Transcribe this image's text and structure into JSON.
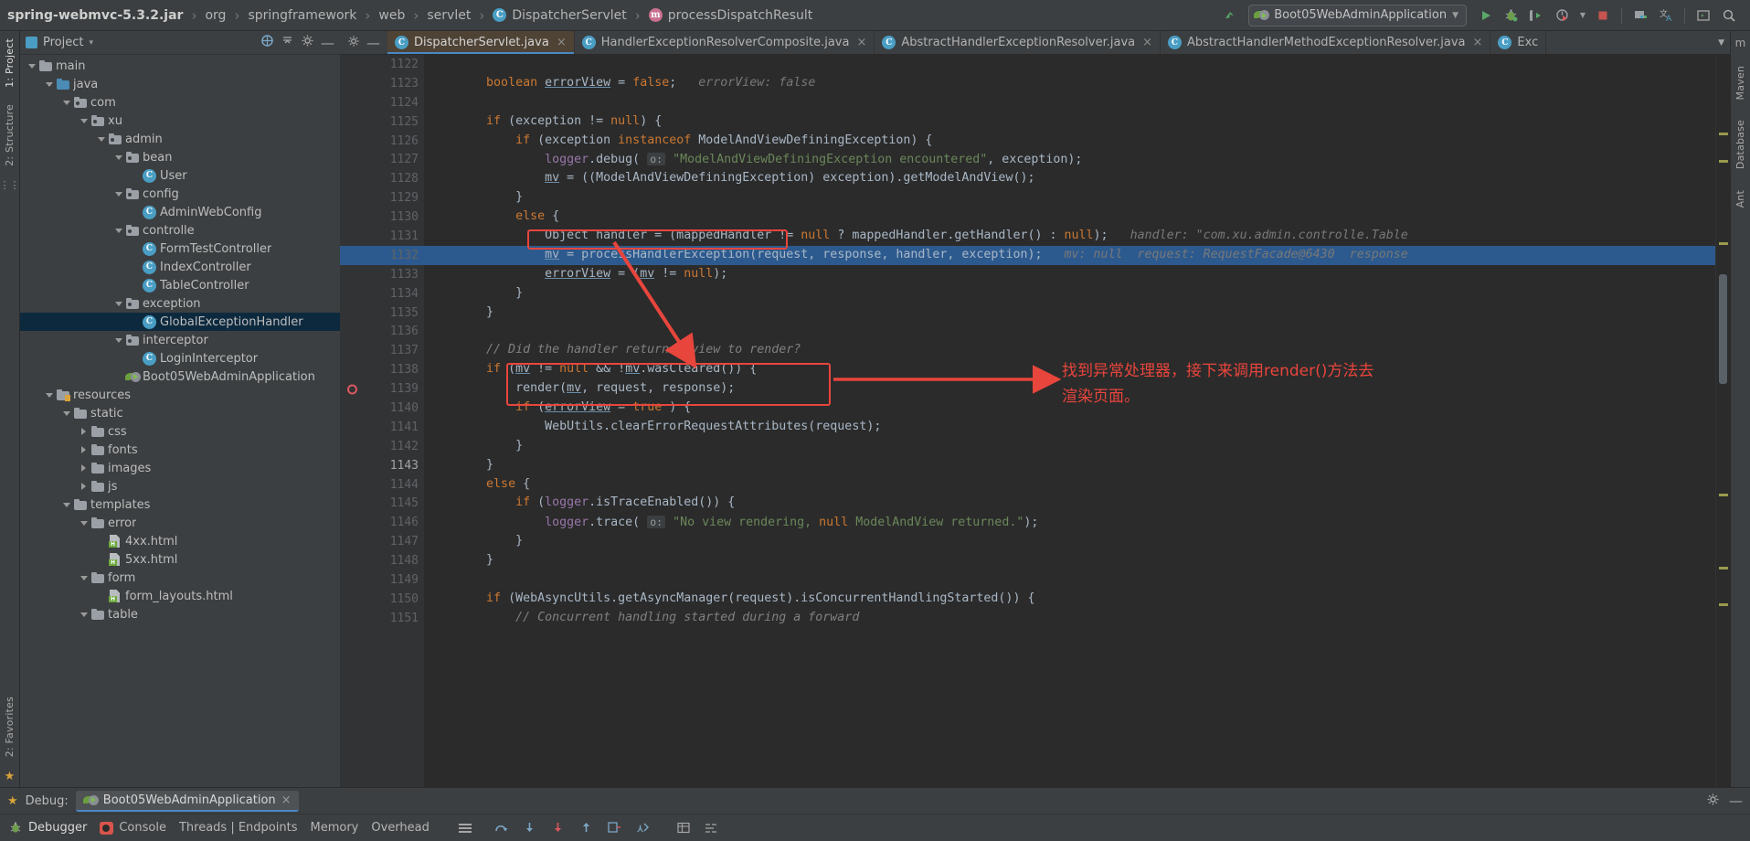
{
  "breadcrumb": {
    "items": [
      {
        "label": "spring-webmvc-5.3.2.jar",
        "icon": "",
        "bold": true
      },
      {
        "label": "org",
        "icon": ""
      },
      {
        "label": "springframework",
        "icon": ""
      },
      {
        "label": "web",
        "icon": ""
      },
      {
        "label": "servlet",
        "icon": ""
      },
      {
        "label": "DispatcherServlet",
        "icon": "class-icon"
      },
      {
        "label": "processDispatchResult",
        "icon": "method-icon"
      }
    ],
    "separator": "›"
  },
  "toolbar": {
    "run_config": "Boot05WebAdminApplication",
    "run_config_chevron": "▼",
    "build_label": "build-icon",
    "run_label": "run-icon",
    "debug_label": "debug-icon",
    "run_coverage_label": "run-with-coverage-icon",
    "profiler_label": "profiler-icon",
    "stop_label": "stop-icon",
    "project_structure_label": "project-structure-icon",
    "translate_label": "translate-icon",
    "terminal_label": "terminal-icon",
    "search_label": "search-icon"
  },
  "project_panel": {
    "title": "Project",
    "title_chevron": "▾",
    "header_icons": [
      "select-opened-file-icon",
      "collapse-all-icon",
      "settings-icon",
      "hide-icon"
    ],
    "tree": [
      {
        "depth": 1,
        "twisty": "down",
        "icon": "folder",
        "label": "main"
      },
      {
        "depth": 2,
        "twisty": "down",
        "icon": "folder-blue",
        "label": "java"
      },
      {
        "depth": 3,
        "twisty": "down",
        "icon": "package",
        "label": "com"
      },
      {
        "depth": 4,
        "twisty": "down",
        "icon": "package",
        "label": "xu"
      },
      {
        "depth": 5,
        "twisty": "down",
        "icon": "package",
        "label": "admin"
      },
      {
        "depth": 6,
        "twisty": "down",
        "icon": "package",
        "label": "bean"
      },
      {
        "depth": 7,
        "twisty": "none",
        "icon": "class",
        "label": "User"
      },
      {
        "depth": 6,
        "twisty": "down",
        "icon": "package",
        "label": "config"
      },
      {
        "depth": 7,
        "twisty": "none",
        "icon": "class",
        "label": "AdminWebConfig"
      },
      {
        "depth": 6,
        "twisty": "down",
        "icon": "package",
        "label": "controlle"
      },
      {
        "depth": 7,
        "twisty": "none",
        "icon": "class",
        "label": "FormTestController"
      },
      {
        "depth": 7,
        "twisty": "none",
        "icon": "class",
        "label": "IndexController"
      },
      {
        "depth": 7,
        "twisty": "none",
        "icon": "class",
        "label": "TableController"
      },
      {
        "depth": 6,
        "twisty": "down",
        "icon": "package",
        "label": "exception"
      },
      {
        "depth": 7,
        "twisty": "none",
        "icon": "class",
        "label": "GlobalExceptionHandler",
        "selected": true
      },
      {
        "depth": 6,
        "twisty": "down",
        "icon": "package",
        "label": "interceptor"
      },
      {
        "depth": 7,
        "twisty": "none",
        "icon": "class",
        "label": "LoginInterceptor"
      },
      {
        "depth": 6,
        "twisty": "none",
        "icon": "spring-boot",
        "label": "Boot05WebAdminApplication"
      },
      {
        "depth": 2,
        "twisty": "down",
        "icon": "resources",
        "label": "resources"
      },
      {
        "depth": 3,
        "twisty": "down",
        "icon": "folder",
        "label": "static"
      },
      {
        "depth": 4,
        "twisty": "right",
        "icon": "folder",
        "label": "css"
      },
      {
        "depth": 4,
        "twisty": "right",
        "icon": "folder",
        "label": "fonts"
      },
      {
        "depth": 4,
        "twisty": "right",
        "icon": "folder",
        "label": "images"
      },
      {
        "depth": 4,
        "twisty": "right",
        "icon": "folder",
        "label": "js"
      },
      {
        "depth": 3,
        "twisty": "down",
        "icon": "folder",
        "label": "templates"
      },
      {
        "depth": 4,
        "twisty": "down",
        "icon": "folder",
        "label": "error"
      },
      {
        "depth": 5,
        "twisty": "none",
        "icon": "html",
        "label": "4xx.html"
      },
      {
        "depth": 5,
        "twisty": "none",
        "icon": "html",
        "label": "5xx.html"
      },
      {
        "depth": 4,
        "twisty": "down",
        "icon": "folder",
        "label": "form"
      },
      {
        "depth": 5,
        "twisty": "none",
        "icon": "html",
        "label": "form_layouts.html"
      },
      {
        "depth": 4,
        "twisty": "down",
        "icon": "folder",
        "label": "table"
      }
    ]
  },
  "left_rail": {
    "top": "1: Project",
    "middle": "2: Structure",
    "bottom": "2: Favorites",
    "bottom_icon": "star-icon"
  },
  "right_rail": {
    "items": [
      "m",
      "Maven",
      "Database",
      "Ant"
    ]
  },
  "editor_tabs": [
    {
      "label": "DispatcherServlet.java",
      "icon": "class-icon",
      "active": true,
      "close": "×"
    },
    {
      "label": "HandlerExceptionResolverComposite.java",
      "icon": "class-icon",
      "active": false,
      "close": "×"
    },
    {
      "label": "AbstractHandlerExceptionResolver.java",
      "icon": "class-icon",
      "active": false,
      "close": "×"
    },
    {
      "label": "AbstractHandlerMethodExceptionResolver.java",
      "icon": "class-icon",
      "active": false,
      "close": "×"
    },
    {
      "label": "Exc",
      "icon": "class-icon",
      "active": false,
      "close": ""
    }
  ],
  "editor": {
    "first_line_number": 1122,
    "highlighted_line": 1132,
    "breakpoint_line": 1139,
    "current_line": 1143,
    "lines": [
      {
        "num": 1122,
        "text": ""
      },
      {
        "num": 1123,
        "text": "boolean errorView = false;   errorView: false"
      },
      {
        "num": 1124,
        "text": ""
      },
      {
        "num": 1125,
        "text": "if (exception != null) {"
      },
      {
        "num": 1126,
        "text": "    if (exception instanceof ModelAndViewDefiningException) {"
      },
      {
        "num": 1127,
        "text": "        logger.debug( o: \"ModelAndViewDefiningException encountered\", exception);"
      },
      {
        "num": 1128,
        "text": "        mv = ((ModelAndViewDefiningException) exception).getModelAndView();"
      },
      {
        "num": 1129,
        "text": "    }"
      },
      {
        "num": 1130,
        "text": "    else {"
      },
      {
        "num": 1131,
        "text": "        Object handler = (mappedHandler != null ? mappedHandler.getHandler() : null);   handler: \"com.xu.admin.controlle.Table"
      },
      {
        "num": 1132,
        "text": "        mv = processHandlerException(request, response, handler, exception);   mv: null  request: RequestFacade@6430  response"
      },
      {
        "num": 1133,
        "text": "        errorView = (mv != null);"
      },
      {
        "num": 1134,
        "text": "    }"
      },
      {
        "num": 1135,
        "text": "}"
      },
      {
        "num": 1136,
        "text": ""
      },
      {
        "num": 1137,
        "text": "// Did the handler return a view to render?"
      },
      {
        "num": 1138,
        "text": "if (mv != null && !mv.wasCleared()) {"
      },
      {
        "num": 1139,
        "text": "    render(mv, request, response);"
      },
      {
        "num": 1140,
        "text": "    if (errorView = true ) {"
      },
      {
        "num": 1141,
        "text": "        WebUtils.clearErrorRequestAttributes(request);"
      },
      {
        "num": 1142,
        "text": "    }"
      },
      {
        "num": 1143,
        "text": "}"
      },
      {
        "num": 1144,
        "text": "else {"
      },
      {
        "num": 1145,
        "text": "    if (logger.isTraceEnabled()) {"
      },
      {
        "num": 1146,
        "text": "        logger.trace( o: \"No view rendering, null ModelAndView returned.\");"
      },
      {
        "num": 1147,
        "text": "    }"
      },
      {
        "num": 1148,
        "text": "}"
      },
      {
        "num": 1149,
        "text": ""
      },
      {
        "num": 1150,
        "text": "if (WebAsyncUtils.getAsyncManager(request).isConcurrentHandlingStarted()) {"
      },
      {
        "num": 1151,
        "text": "    // Concurrent handling started during a forward"
      }
    ]
  },
  "annotation": {
    "text_line1": "找到异常处理器，接下来调用render()方法去",
    "text_line2": "渲染页面。",
    "color": "#e8453c"
  },
  "debug_panel": {
    "title": "Debug:",
    "session_name": "Boot05WebAdminApplication",
    "session_close": "×",
    "settings_icon": "gear-icon",
    "minimize_icon": "minimize-icon",
    "tabs": [
      {
        "label": "Debugger",
        "icon": "debugger-icon"
      },
      {
        "label": "Console",
        "icon": "console-icon"
      },
      {
        "label": "Threads | Endpoints",
        "icon": ""
      },
      {
        "label": "Memory",
        "icon": ""
      },
      {
        "label": "Overhead",
        "icon": ""
      }
    ],
    "right_icons": [
      "layout-icon",
      "step-over-icon",
      "step-into-icon",
      "force-step-into-icon",
      "step-out-icon",
      "run-to-cursor-icon",
      "evaluate-icon",
      "table-icon",
      "settings2-icon"
    ]
  },
  "colors": {
    "accent_blue": "#4a88c7",
    "selection_blue": "#2d5a8e",
    "annotation_red": "#e8453c",
    "tab_active_bg": "#4e4335",
    "editor_bg": "#2b2b2b",
    "panel_bg": "#3c3f41"
  }
}
